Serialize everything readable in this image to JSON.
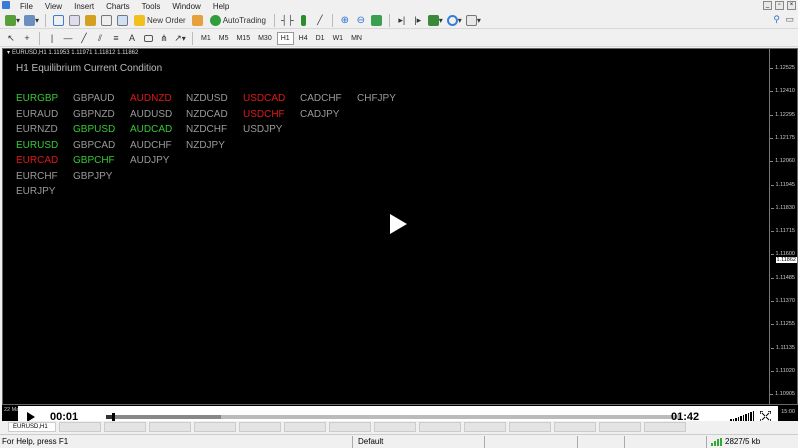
{
  "menubar": {
    "items": [
      "File",
      "View",
      "Insert",
      "Charts",
      "Tools",
      "Window",
      "Help"
    ]
  },
  "toolbar": {
    "new_order_label": "New Order",
    "autotrading_label": "AutoTrading"
  },
  "timeframes": [
    "M1",
    "M5",
    "M15",
    "M30",
    "H1",
    "H4",
    "D1",
    "W1",
    "MN"
  ],
  "chart": {
    "header": "EURUSD,H1 1.11953 1.11971 1.11812 1.11862",
    "indicator_title": "H1 Equilibrium Current Condition",
    "colors": {
      "bullish": "#38c838",
      "bearish": "#e01818",
      "neutral": "#9a9a9a"
    },
    "pair_columns": [
      [
        {
          "name": "EURGBP",
          "state": "bullish"
        },
        {
          "name": "EURAUD",
          "state": "neutral"
        },
        {
          "name": "EURNZD",
          "state": "neutral"
        },
        {
          "name": "EURUSD",
          "state": "bullish"
        },
        {
          "name": "EURCAD",
          "state": "bearish"
        },
        {
          "name": "EURCHF",
          "state": "neutral"
        },
        {
          "name": "EURJPY",
          "state": "neutral"
        }
      ],
      [
        {
          "name": "GBPAUD",
          "state": "neutral"
        },
        {
          "name": "GBPNZD",
          "state": "neutral"
        },
        {
          "name": "GBPUSD",
          "state": "bullish"
        },
        {
          "name": "GBPCAD",
          "state": "neutral"
        },
        {
          "name": "GBPCHF",
          "state": "bullish"
        },
        {
          "name": "GBPJPY",
          "state": "neutral"
        }
      ],
      [
        {
          "name": "AUDNZD",
          "state": "bearish"
        },
        {
          "name": "AUDUSD",
          "state": "neutral"
        },
        {
          "name": "AUDCAD",
          "state": "bullish"
        },
        {
          "name": "AUDCHF",
          "state": "neutral"
        },
        {
          "name": "AUDJPY",
          "state": "neutral"
        }
      ],
      [
        {
          "name": "NZDUSD",
          "state": "neutral"
        },
        {
          "name": "NZDCAD",
          "state": "neutral"
        },
        {
          "name": "NZDCHF",
          "state": "neutral"
        },
        {
          "name": "NZDJPY",
          "state": "neutral"
        }
      ],
      [
        {
          "name": "USDCAD",
          "state": "bearish"
        },
        {
          "name": "USDCHF",
          "state": "bearish"
        },
        {
          "name": "USDJPY",
          "state": "neutral"
        }
      ],
      [
        {
          "name": "CADCHF",
          "state": "neutral"
        },
        {
          "name": "CADJPY",
          "state": "neutral"
        }
      ],
      [
        {
          "name": "CHFJPY",
          "state": "neutral"
        }
      ]
    ],
    "price_labels": [
      "1.12525",
      "1.12410",
      "1.12295",
      "1.12175",
      "1.12060",
      "1.11945",
      "1.11830",
      "1.11715",
      "1.11600",
      "1.11485",
      "1.11370",
      "1.11255",
      "1.11135",
      "1.11020",
      "1.10905"
    ],
    "current_price": "1.11862",
    "date_left": "22 Ma",
    "date_right": "15:00"
  },
  "video": {
    "current_time": "00:01",
    "total_time": "01:42",
    "progress_fraction": 0.01,
    "buffered_fraction": 0.2
  },
  "tabs": [
    "EURUSD,H1",
    "",
    "",
    "",
    "",
    "",
    "",
    "",
    "",
    "",
    "",
    "",
    "",
    "",
    ""
  ],
  "status": {
    "help": "For Help, press F1",
    "profile": "Default",
    "connection": "2827/5 kb"
  }
}
